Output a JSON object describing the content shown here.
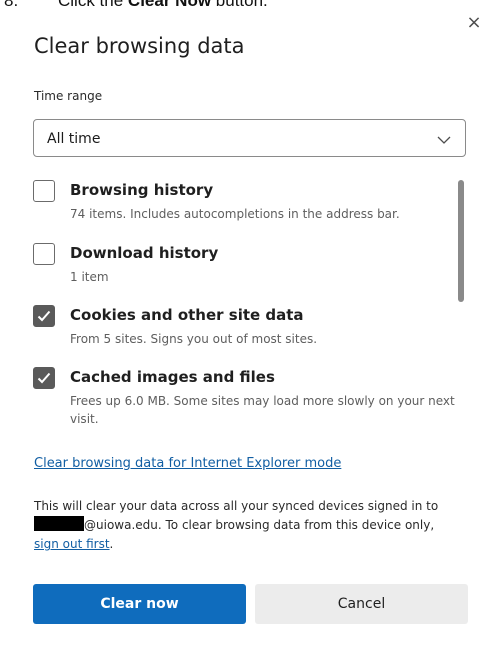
{
  "instruction": {
    "step": "8.",
    "prefix": "Click the ",
    "button_name": "Clear Now",
    "suffix": " button."
  },
  "dialog": {
    "close_glyph": "×",
    "title": "Clear browsing data",
    "time_range_label": "Time range",
    "time_range_value": "All time",
    "items": [
      {
        "label": "Browsing history",
        "description": "74 items. Includes autocompletions in the address bar.",
        "checked": false
      },
      {
        "label": "Download history",
        "description": "1 item",
        "checked": false
      },
      {
        "label": "Cookies and other site data",
        "description": "From 5 sites. Signs you out of most sites.",
        "checked": true
      },
      {
        "label": "Cached images and files",
        "description": "Frees up 6.0 MB. Some sites may load more slowly on your next visit.",
        "checked": true
      }
    ],
    "ie_mode_link": "Clear browsing data for Internet Explorer mode",
    "sync_notice": {
      "line1": "This will clear your data across all your synced devices signed in to",
      "line2_after_redaction": "@uiowa.edu. To clear browsing data from this device only,",
      "sign_out_link": "sign out first",
      "end_punct": "."
    },
    "buttons": {
      "clear_now": "Clear now",
      "cancel": "Cancel"
    }
  },
  "colors": {
    "primary_button": "#0f6cbd",
    "link": "#115ea3",
    "checkbox_checked": "#5a5a5a",
    "secondary_button": "#ececec"
  },
  "icons": {
    "close": "close-icon",
    "dropdown": "chevron-down-icon",
    "check": "checkmark-icon"
  }
}
